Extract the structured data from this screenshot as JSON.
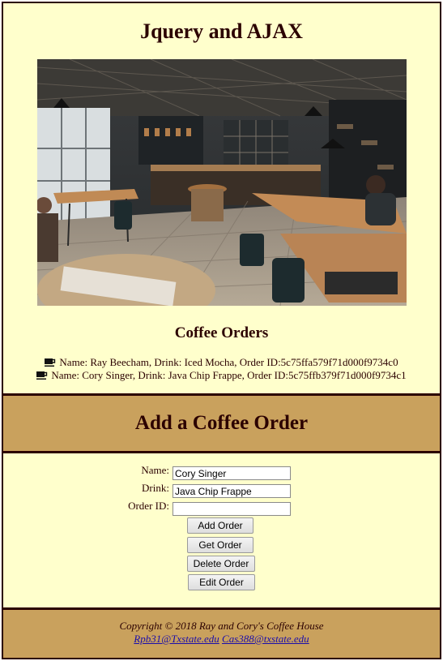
{
  "header": {
    "title": "Jquery and AJAX"
  },
  "orders_section": {
    "title": "Coffee Orders",
    "orders": [
      "Name: Ray Beecham, Drink: Iced Mocha, Order ID:5c75ffa579f71d000f9734c0",
      "Name: Cory Singer, Drink: Java Chip Frappe, Order ID:5c75ffb379f71d000f9734c1"
    ]
  },
  "form": {
    "title": "Add a Coffee Order",
    "name_label": "Name:",
    "name_value": "Cory Singer",
    "drink_label": "Drink:",
    "drink_value": "Java Chip Frappe",
    "orderid_label": "Order ID:",
    "orderid_value": "",
    "buttons": {
      "add": "Add Order",
      "get": "Get Order",
      "delete": "Delete Order",
      "edit": "Edit Order"
    }
  },
  "footer": {
    "copyright": "Copyright © 2018 Ray and Cory's Coffee House",
    "email1": "Rpb31@Txstate.edu",
    "email2": "Cas388@txstate.edu"
  },
  "colors": {
    "cream": "#ffffcc",
    "tan": "#c9a15d",
    "dark": "#2b0000"
  }
}
